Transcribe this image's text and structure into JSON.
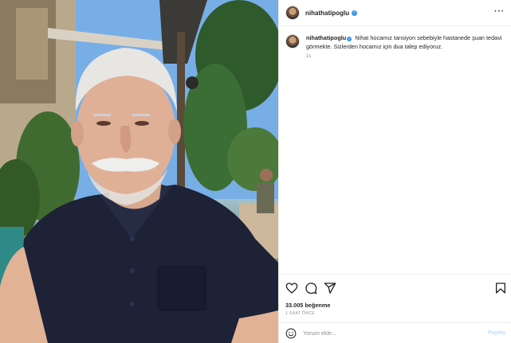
{
  "post": {
    "username": "nihathatipoglu",
    "caption_text": "Nihat hocamız tansiyon sebebiyle hastanede şuan tedavi görmekte. Sizlerden hocamız için dua talep ediyoruz.",
    "caption_time": "1s",
    "likes": "33.005 beğenme",
    "time_ago": "1 SAAT ÖNCE"
  },
  "comment": {
    "placeholder": "Yorum ekle...",
    "post_label": "Paylaş"
  },
  "icons": {
    "more": "more-options-icon",
    "like": "heart-icon",
    "comment": "comment-icon",
    "share": "share-icon",
    "save": "bookmark-icon",
    "emoji": "emoji-icon",
    "verified": "verified-badge-icon"
  },
  "colors": {
    "verified": "#3897f0",
    "post_button_disabled": "#c0dffd",
    "muted_text": "#8e8e8e"
  }
}
